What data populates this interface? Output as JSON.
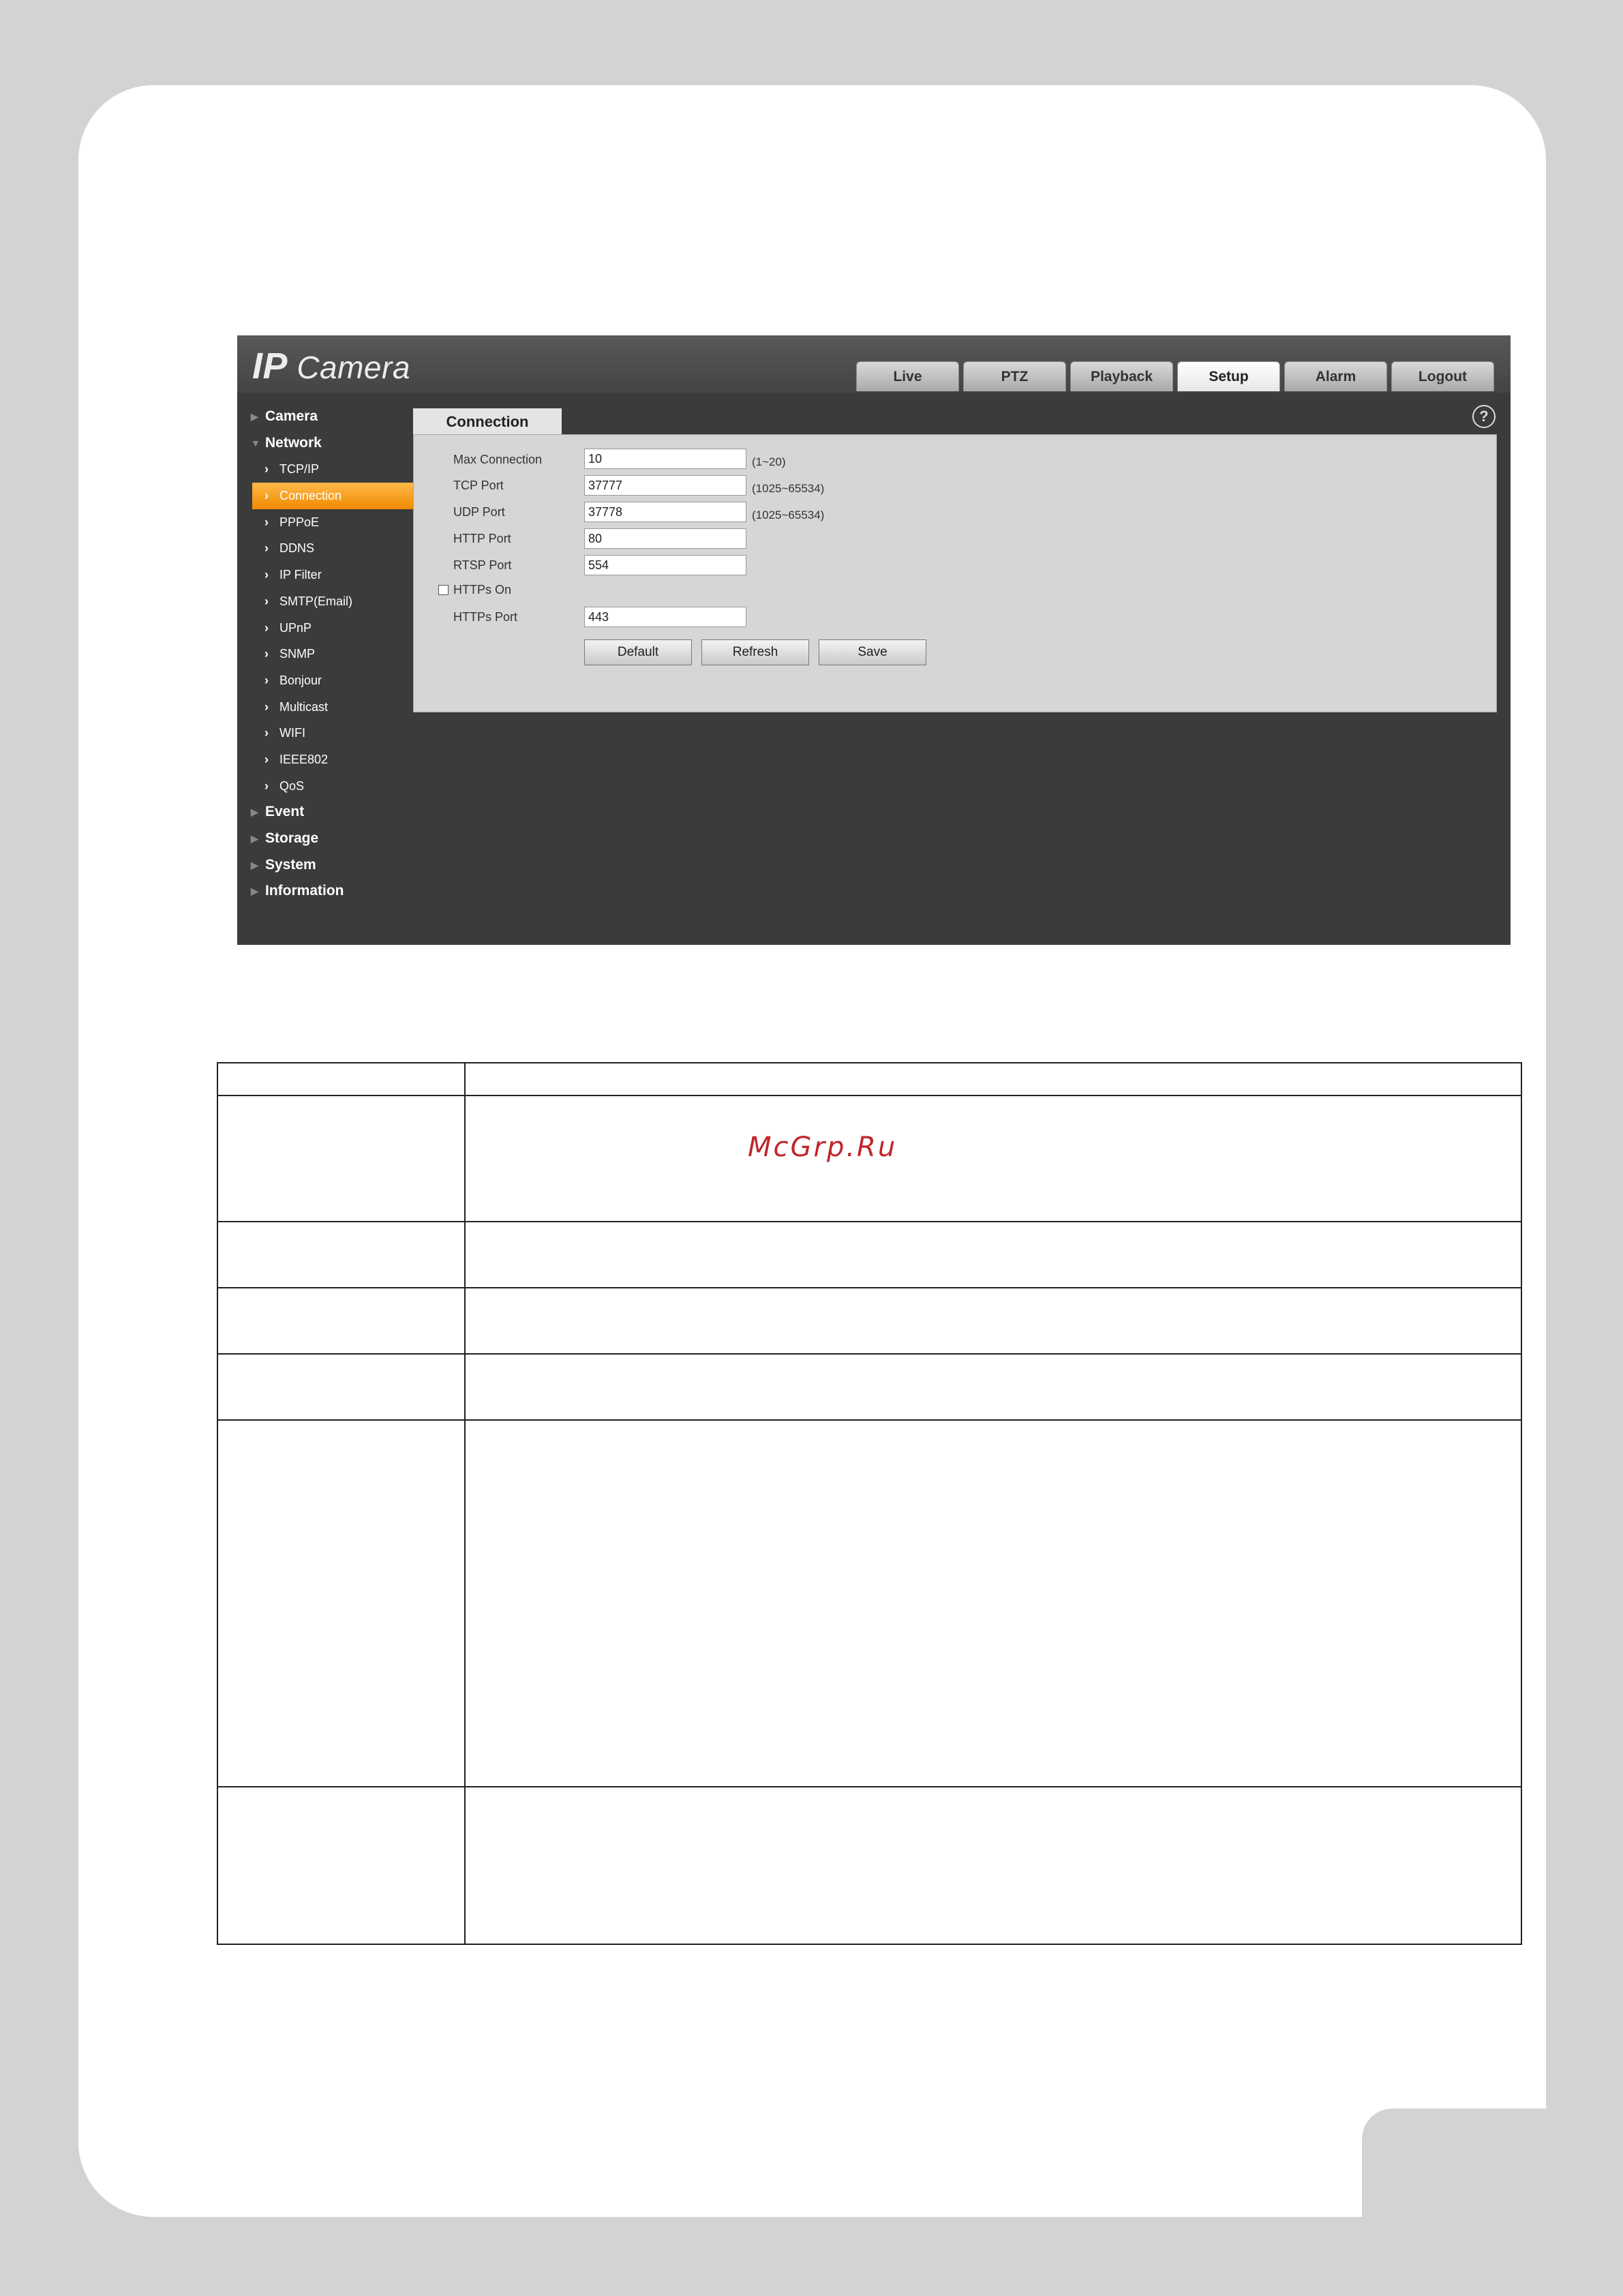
{
  "app": {
    "logo_ip": "IP",
    "logo_name": "Camera"
  },
  "tabs": [
    "Live",
    "PTZ",
    "Playback",
    "Setup",
    "Alarm",
    "Logout"
  ],
  "active_tab": "Setup",
  "sidebar": {
    "camera": "Camera",
    "network": "Network",
    "items": [
      "TCP/IP",
      "Connection",
      "PPPoE",
      "DDNS",
      "IP Filter",
      "SMTP(Email)",
      "UPnP",
      "SNMP",
      "Bonjour",
      "Multicast",
      "WIFI",
      "IEEE802",
      "QoS"
    ],
    "selected": "Connection",
    "event": "Event",
    "storage": "Storage",
    "system": "System",
    "information": "Information"
  },
  "panel": {
    "tab_label": "Connection",
    "help": "?",
    "fields": [
      {
        "label": "Max Connection",
        "value": "10",
        "range": "(1~20)"
      },
      {
        "label": "TCP Port",
        "value": "37777",
        "range": "(1025~65534)"
      },
      {
        "label": "UDP Port",
        "value": "37778",
        "range": "(1025~65534)"
      },
      {
        "label": "HTTP Port",
        "value": "80",
        "range": ""
      },
      {
        "label": "RTSP Port",
        "value": "554",
        "range": ""
      }
    ],
    "https_on": "HTTPs On",
    "https_port_label": "HTTPs Port",
    "https_port_value": "443",
    "buttons": {
      "default": "Default",
      "refresh": "Refresh",
      "save": "Save"
    }
  },
  "watermark": "McGrp.Ru"
}
